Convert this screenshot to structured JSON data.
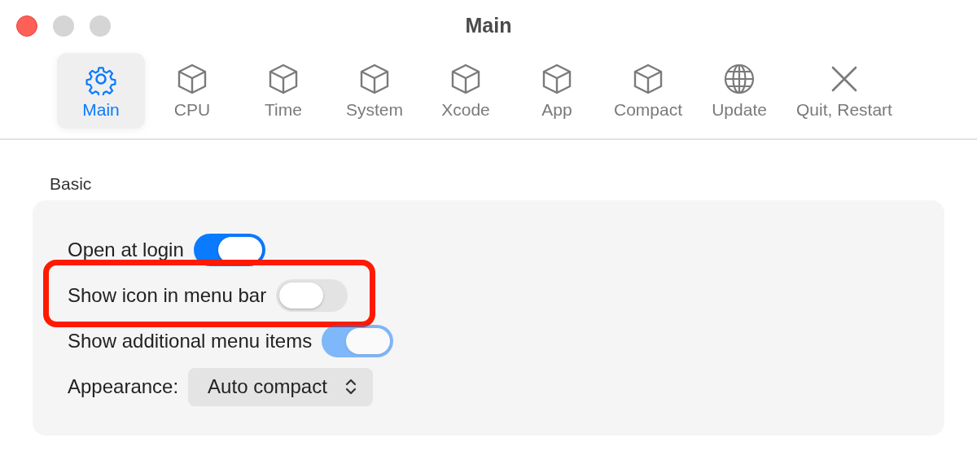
{
  "window": {
    "title": "Main"
  },
  "toolbar": [
    {
      "label": "Main",
      "selected": true
    },
    {
      "label": "CPU",
      "selected": false
    },
    {
      "label": "Time",
      "selected": false
    },
    {
      "label": "System",
      "selected": false
    },
    {
      "label": "Xcode",
      "selected": false
    },
    {
      "label": "App",
      "selected": false
    },
    {
      "label": "Compact",
      "selected": false
    },
    {
      "label": "Update",
      "selected": false
    },
    {
      "label": "Quit, Restart",
      "selected": false
    }
  ],
  "section": {
    "title": "Basic"
  },
  "settings": [
    {
      "label": "Open at login",
      "on": true,
      "disabled": false,
      "highlighted": false
    },
    {
      "label": "Show icon in menu bar",
      "on": false,
      "disabled": false,
      "highlighted": true
    },
    {
      "label": "Show additional menu items",
      "on": true,
      "disabled": true,
      "highlighted": false
    }
  ],
  "appearance": {
    "label": "Appearance:",
    "value": "Auto compact"
  }
}
